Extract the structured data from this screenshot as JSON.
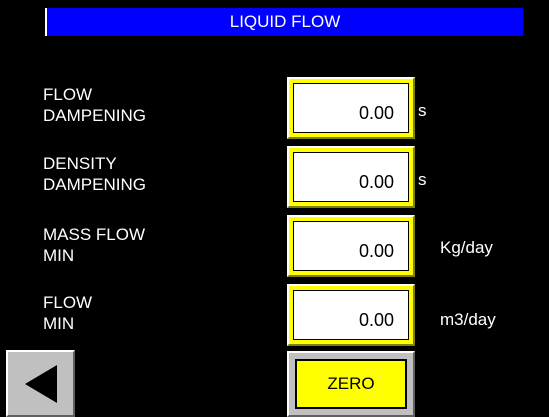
{
  "title": "LIQUID FLOW",
  "rows": [
    {
      "label": "FLOW\nDAMPENING",
      "value": "0.00",
      "unit": "s"
    },
    {
      "label": "DENSITY\nDAMPENING",
      "value": "0.00",
      "unit": "s"
    },
    {
      "label": "MASS FLOW\nMIN",
      "value": "0.00",
      "unit": "Kg/day"
    },
    {
      "label": "FLOW\nMIN",
      "value": "0.00",
      "unit": "m3/day"
    }
  ],
  "zero_label": "ZERO",
  "back_icon": "left-arrow-icon",
  "colors": {
    "title_bg": "#0000ff",
    "field_frame": "#ffff00",
    "zero_button": "#ffff00",
    "background": "#000000"
  }
}
